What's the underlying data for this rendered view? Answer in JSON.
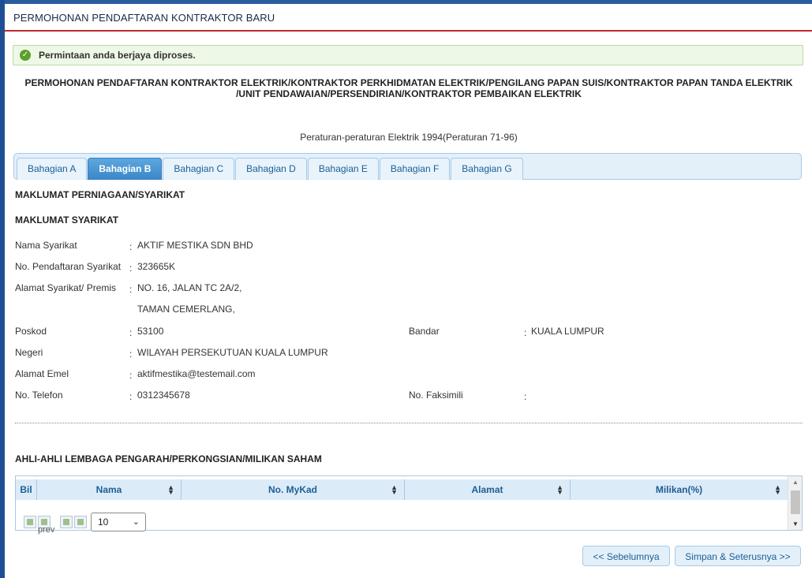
{
  "page": {
    "title": "PERMOHONAN PENDAFTARAN KONTRAKTOR BARU"
  },
  "alert": {
    "message": "Permintaan anda berjaya diproses.",
    "color": "#5aa02c"
  },
  "form": {
    "heading_line1": "PERMOHONAN PENDAFTARAN KONTRAKTOR ELEKTRIK/KONTRAKTOR PERKHIDMATAN ELEKTRIK/PENGILANG PAPAN SUIS/KONTRAKTOR PAPAN TANDA ELEKTRIK",
    "heading_line2": "/UNIT PENDAWAIAN/PERSENDIRIAN/KONTRAKTOR PEMBAIKAN ELEKTRIK",
    "regulation": "Peraturan-peraturan Elektrik 1994(Peraturan 71-96)"
  },
  "tabs": [
    {
      "label": "Bahagian A",
      "active": false
    },
    {
      "label": "Bahagian B",
      "active": true
    },
    {
      "label": "Bahagian C",
      "active": false
    },
    {
      "label": "Bahagian D",
      "active": false
    },
    {
      "label": "Bahagian E",
      "active": false
    },
    {
      "label": "Bahagian F",
      "active": false
    },
    {
      "label": "Bahagian G",
      "active": false
    }
  ],
  "section": {
    "business_heading": "MAKLUMAT PERNIAGAAN/SYARIKAT",
    "company_heading": "MAKLUMAT SYARIKAT",
    "board_heading": "AHLI-AHLI LEMBAGA PENGARAH/PERKONGSIAN/MILIKAN SAHAM"
  },
  "company": {
    "name_label": "Nama Syarikat",
    "name_value": "AKTIF MESTIKA SDN BHD",
    "reg_label": "No. Pendaftaran Syarikat",
    "reg_value": "323665K",
    "address_label": "Alamat Syarikat/ Premis",
    "address_line1": "NO. 16, JALAN TC 2A/2,",
    "address_line2": "TAMAN CEMERLANG,",
    "postcode_label": "Poskod",
    "postcode_value": "53100",
    "city_label": "Bandar",
    "city_value": "KUALA LUMPUR",
    "state_label": "Negeri",
    "state_value": "WILAYAH PERSEKUTUAN KUALA LUMPUR",
    "email_label": "Alamat Emel",
    "email_value": "aktifmestika@testemail.com",
    "phone_label": "No. Telefon",
    "phone_value": "0312345678",
    "fax_label": "No. Faksimili",
    "fax_value": ""
  },
  "colon": ":",
  "grid": {
    "columns": [
      "Bil",
      "Nama",
      "No. MyKad",
      "Alamat",
      "Milikan(%)"
    ],
    "prev_text": "prev",
    "page_size": "10"
  },
  "buttons": {
    "back": "<< Sebelumnya",
    "next": "Simpan & Seterusnya >>"
  }
}
